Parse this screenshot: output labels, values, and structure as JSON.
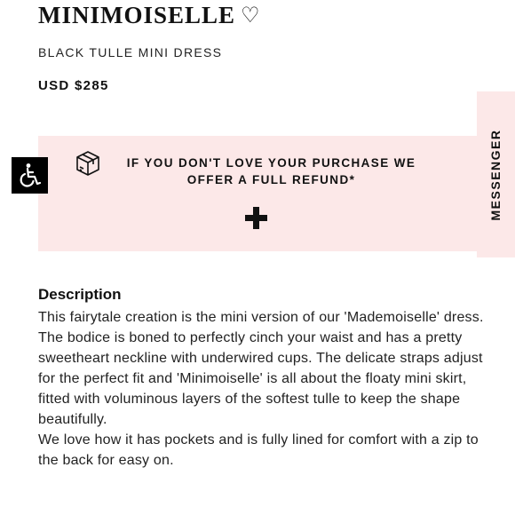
{
  "product": {
    "title": "MINIMOISELLE",
    "heart_icon": "heart-outline-icon",
    "subtitle": "BLACK TULLE MINI DRESS",
    "price": "USD $285"
  },
  "promo": {
    "icon": "box-icon",
    "message": "IF YOU DON'T LOVE YOUR PURCHASE WE OFFER A FULL REFUND*",
    "expand_icon": "plus-icon",
    "background": "#fce8e8"
  },
  "messenger": {
    "label": "MESSENGER"
  },
  "accessibility": {
    "icon": "wheelchair-icon"
  },
  "description": {
    "heading": "Description",
    "paragraphs": [
      "This fairytale creation is the mini version of our 'Mademoiselle' dress. The bodice is boned to perfectly cinch your waist and has a pretty sweetheart neckline with underwired cups. The delicate straps adjust for the perfect fit and 'Minimoiselle' is all about the floaty mini skirt, fitted with voluminous layers of the softest tulle to keep the shape beautifully.",
      "We love how it has pockets and is fully lined for comfort with a zip to the back for easy on."
    ]
  }
}
